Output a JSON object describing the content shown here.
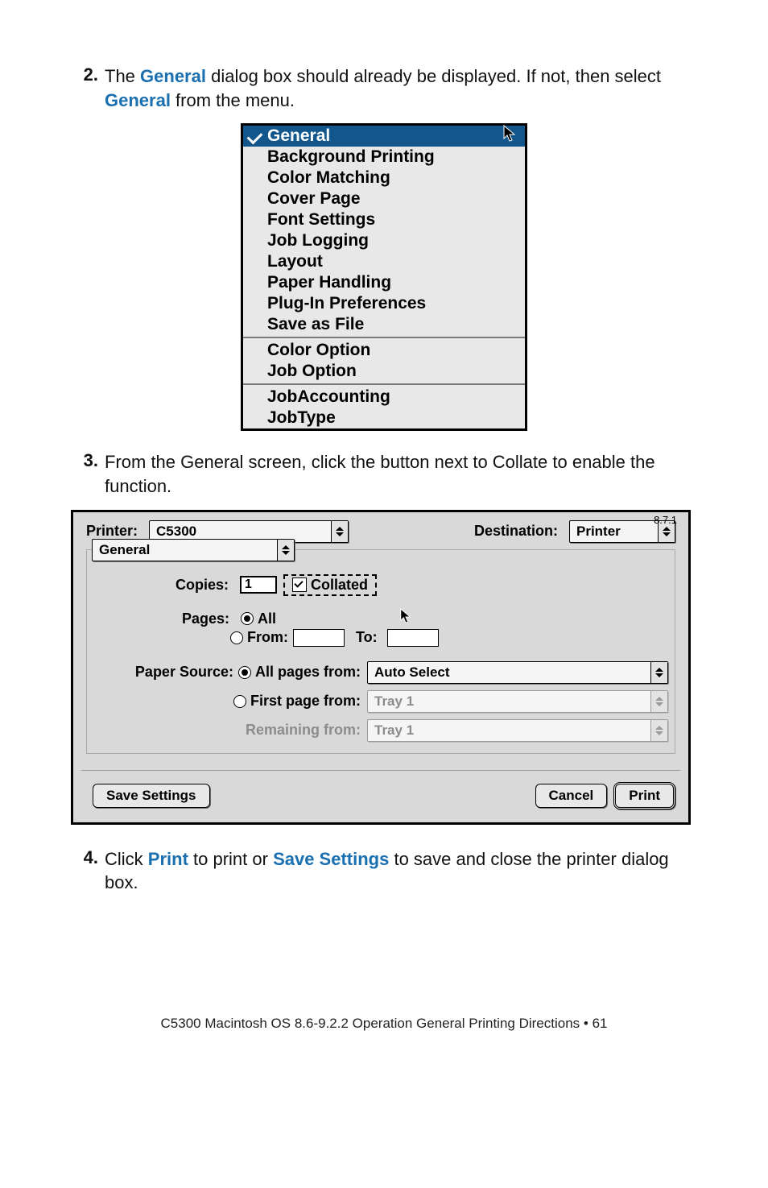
{
  "steps": {
    "2": {
      "num": "2.",
      "text_before": "The ",
      "kw1": "General",
      "text_mid1": " dialog box should already be displayed.  If not, then select ",
      "kw2": "General",
      "text_after": " from the menu."
    },
    "3": {
      "num": "3.",
      "text": "From the General screen, click the button next to Collate to enable the function."
    },
    "4": {
      "num": "4.",
      "text_before": "Click ",
      "kw1": "Print",
      "text_mid1": " to print or ",
      "kw2": "Save Settings",
      "text_after": " to save and close the printer dialog box."
    }
  },
  "menu": {
    "items": [
      "General",
      "Background Printing",
      "Color Matching",
      "Cover Page",
      "Font Settings",
      "Job Logging",
      "Layout",
      "Paper Handling",
      "Plug-In Preferences",
      "Save as File"
    ],
    "group2": [
      "Color Option",
      "Job Option"
    ],
    "group3": [
      "JobAccounting",
      "JobType"
    ]
  },
  "dialog": {
    "version": "8.7.1",
    "printer_label": "Printer:",
    "printer_value": "C5300",
    "destination_label": "Destination:",
    "destination_value": "Printer",
    "section_value": "General",
    "copies_label": "Copies:",
    "copies_value": "1",
    "collated_label": "Collated",
    "pages_label": "Pages:",
    "pages_all": "All",
    "pages_from_label": "From:",
    "pages_to_label": "To:",
    "paper_source_label": "Paper Source:",
    "all_pages_from_label": "All pages from:",
    "all_pages_from_value": "Auto Select",
    "first_page_from_label": "First page from:",
    "first_page_from_value": "Tray 1",
    "remaining_from_label": "Remaining from:",
    "remaining_from_value": "Tray 1",
    "save_settings": "Save Settings",
    "cancel": "Cancel",
    "print": "Print"
  },
  "footer": "C5300 Macintosh OS 8.6-9.2.2 Operation General Printing Directions • 61"
}
